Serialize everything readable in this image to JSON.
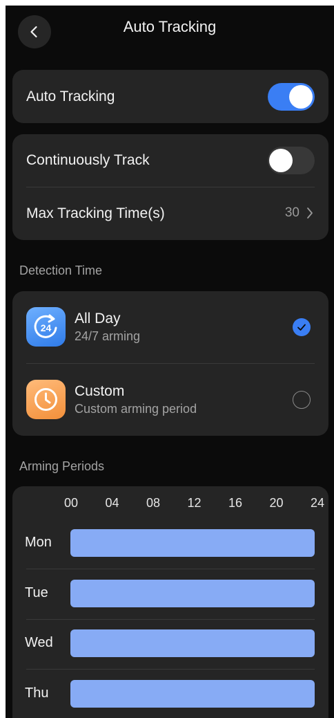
{
  "header": {
    "title": "Auto Tracking",
    "back_icon": "chevron-left-icon"
  },
  "auto_tracking": {
    "label": "Auto Tracking",
    "enabled": true
  },
  "tracking_settings": {
    "continuous_label": "Continuously Track",
    "continuous_enabled": false,
    "max_time_label": "Max Tracking Time(s)",
    "max_time_value": "30"
  },
  "detection_time": {
    "section_title": "Detection Time",
    "options": [
      {
        "title": "All Day",
        "subtitle": "24/7 arming",
        "icon": "clock-24-icon",
        "selected": true
      },
      {
        "title": "Custom",
        "subtitle": "Custom arming period",
        "icon": "clock-icon",
        "selected": false
      }
    ]
  },
  "arming_periods": {
    "section_title": "Arming Periods",
    "hours": [
      "00",
      "04",
      "08",
      "12",
      "16",
      "20",
      "24"
    ],
    "days": [
      {
        "label": "Mon",
        "start": 0,
        "end": 24
      },
      {
        "label": "Tue",
        "start": 0,
        "end": 24
      },
      {
        "label": "Wed",
        "start": 0,
        "end": 24
      },
      {
        "label": "Thu",
        "start": 0,
        "end": 24
      }
    ]
  },
  "colors": {
    "accent": "#3a7ef4",
    "bar": "#87abf5",
    "background": "#0b0b0b",
    "card": "#252525"
  }
}
